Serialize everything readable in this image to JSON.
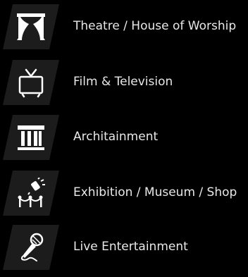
{
  "menu": {
    "items": [
      {
        "label": "Theatre / House of Worship",
        "icon": "theatre-curtains-icon"
      },
      {
        "label": "Film & Television",
        "icon": "television-icon"
      },
      {
        "label": "Architainment",
        "icon": "classical-building-icon"
      },
      {
        "label": "Exhibition / Museum / Shop",
        "icon": "spotlight-rope-barrier-icon"
      },
      {
        "label": "Live Entertainment",
        "icon": "microphone-icon"
      }
    ]
  },
  "colors": {
    "background": "#000000",
    "tile": "#1c1c1c",
    "icon": "#ffffff",
    "text": "#e8e8e8"
  }
}
